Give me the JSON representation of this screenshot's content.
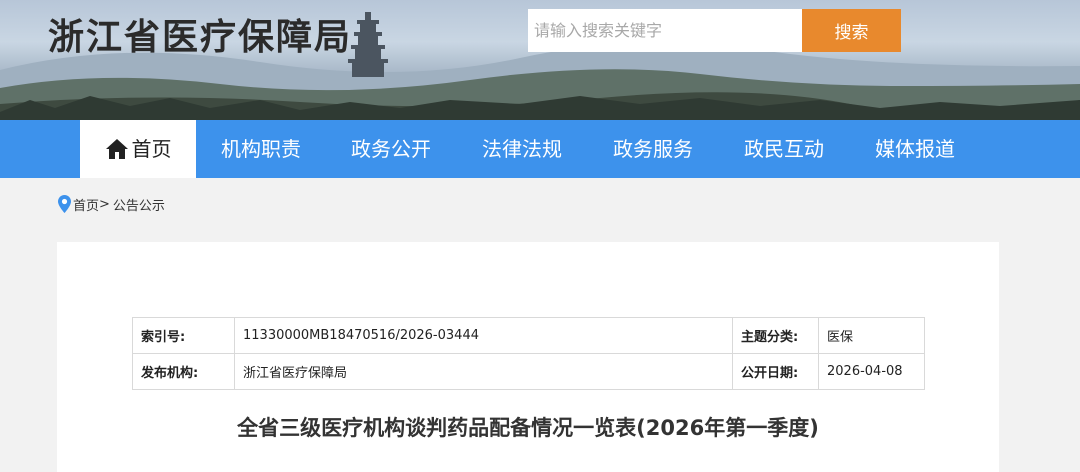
{
  "header": {
    "site_title": "浙江省医疗保障局",
    "search_placeholder": "请输入搜索关键字",
    "search_value": "",
    "search_button_label": "搜索"
  },
  "nav": {
    "items": [
      {
        "label": "首页",
        "icon": "home-icon",
        "active": true
      },
      {
        "label": "机构职责"
      },
      {
        "label": "政务公开"
      },
      {
        "label": "法律法规"
      },
      {
        "label": "政务服务"
      },
      {
        "label": "政民互动"
      },
      {
        "label": "媒体报道"
      }
    ]
  },
  "breadcrumb": {
    "icon": "location-pin-icon",
    "home": "首页",
    "separator": ">",
    "current": "公告公示"
  },
  "meta": {
    "index_label": "索引号:",
    "index_value": "11330000MB18470516/2026-03444",
    "topic_label": "主题分类:",
    "topic_value": "医保",
    "publisher_label": "发布机构:",
    "publisher_value": "浙江省医疗保障局",
    "date_label": "公开日期:",
    "date_value": "2026-04-08"
  },
  "article": {
    "title": "全省三级医疗机构谈判药品配备情况一览表(2026年第一季度)"
  },
  "colors": {
    "nav_bg": "#3d92ec",
    "search_button_bg": "#e8892d",
    "page_bg": "#f2f2f2",
    "pin_icon": "#3d92ec"
  }
}
